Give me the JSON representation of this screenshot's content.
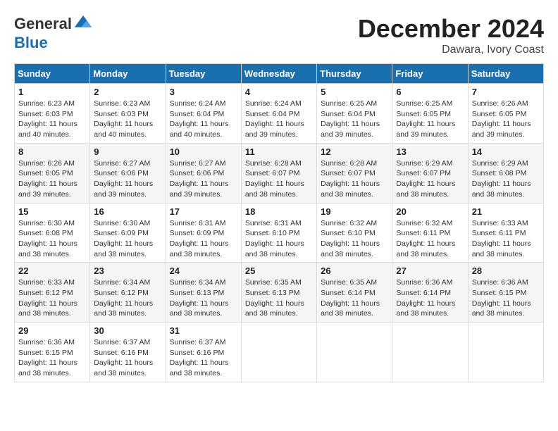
{
  "header": {
    "logo_general": "General",
    "logo_blue": "Blue",
    "month_title": "December 2024",
    "location": "Dawara, Ivory Coast"
  },
  "days_of_week": [
    "Sunday",
    "Monday",
    "Tuesday",
    "Wednesday",
    "Thursday",
    "Friday",
    "Saturday"
  ],
  "weeks": [
    [
      {
        "day": "1",
        "sunrise": "6:23 AM",
        "sunset": "6:03 PM",
        "daylight": "11 hours and 40 minutes."
      },
      {
        "day": "2",
        "sunrise": "6:23 AM",
        "sunset": "6:03 PM",
        "daylight": "11 hours and 40 minutes."
      },
      {
        "day": "3",
        "sunrise": "6:24 AM",
        "sunset": "6:04 PM",
        "daylight": "11 hours and 40 minutes."
      },
      {
        "day": "4",
        "sunrise": "6:24 AM",
        "sunset": "6:04 PM",
        "daylight": "11 hours and 39 minutes."
      },
      {
        "day": "5",
        "sunrise": "6:25 AM",
        "sunset": "6:04 PM",
        "daylight": "11 hours and 39 minutes."
      },
      {
        "day": "6",
        "sunrise": "6:25 AM",
        "sunset": "6:05 PM",
        "daylight": "11 hours and 39 minutes."
      },
      {
        "day": "7",
        "sunrise": "6:26 AM",
        "sunset": "6:05 PM",
        "daylight": "11 hours and 39 minutes."
      }
    ],
    [
      {
        "day": "8",
        "sunrise": "6:26 AM",
        "sunset": "6:05 PM",
        "daylight": "11 hours and 39 minutes."
      },
      {
        "day": "9",
        "sunrise": "6:27 AM",
        "sunset": "6:06 PM",
        "daylight": "11 hours and 39 minutes."
      },
      {
        "day": "10",
        "sunrise": "6:27 AM",
        "sunset": "6:06 PM",
        "daylight": "11 hours and 39 minutes."
      },
      {
        "day": "11",
        "sunrise": "6:28 AM",
        "sunset": "6:07 PM",
        "daylight": "11 hours and 38 minutes."
      },
      {
        "day": "12",
        "sunrise": "6:28 AM",
        "sunset": "6:07 PM",
        "daylight": "11 hours and 38 minutes."
      },
      {
        "day": "13",
        "sunrise": "6:29 AM",
        "sunset": "6:07 PM",
        "daylight": "11 hours and 38 minutes."
      },
      {
        "day": "14",
        "sunrise": "6:29 AM",
        "sunset": "6:08 PM",
        "daylight": "11 hours and 38 minutes."
      }
    ],
    [
      {
        "day": "15",
        "sunrise": "6:30 AM",
        "sunset": "6:08 PM",
        "daylight": "11 hours and 38 minutes."
      },
      {
        "day": "16",
        "sunrise": "6:30 AM",
        "sunset": "6:09 PM",
        "daylight": "11 hours and 38 minutes."
      },
      {
        "day": "17",
        "sunrise": "6:31 AM",
        "sunset": "6:09 PM",
        "daylight": "11 hours and 38 minutes."
      },
      {
        "day": "18",
        "sunrise": "6:31 AM",
        "sunset": "6:10 PM",
        "daylight": "11 hours and 38 minutes."
      },
      {
        "day": "19",
        "sunrise": "6:32 AM",
        "sunset": "6:10 PM",
        "daylight": "11 hours and 38 minutes."
      },
      {
        "day": "20",
        "sunrise": "6:32 AM",
        "sunset": "6:11 PM",
        "daylight": "11 hours and 38 minutes."
      },
      {
        "day": "21",
        "sunrise": "6:33 AM",
        "sunset": "6:11 PM",
        "daylight": "11 hours and 38 minutes."
      }
    ],
    [
      {
        "day": "22",
        "sunrise": "6:33 AM",
        "sunset": "6:12 PM",
        "daylight": "11 hours and 38 minutes."
      },
      {
        "day": "23",
        "sunrise": "6:34 AM",
        "sunset": "6:12 PM",
        "daylight": "11 hours and 38 minutes."
      },
      {
        "day": "24",
        "sunrise": "6:34 AM",
        "sunset": "6:13 PM",
        "daylight": "11 hours and 38 minutes."
      },
      {
        "day": "25",
        "sunrise": "6:35 AM",
        "sunset": "6:13 PM",
        "daylight": "11 hours and 38 minutes."
      },
      {
        "day": "26",
        "sunrise": "6:35 AM",
        "sunset": "6:14 PM",
        "daylight": "11 hours and 38 minutes."
      },
      {
        "day": "27",
        "sunrise": "6:36 AM",
        "sunset": "6:14 PM",
        "daylight": "11 hours and 38 minutes."
      },
      {
        "day": "28",
        "sunrise": "6:36 AM",
        "sunset": "6:15 PM",
        "daylight": "11 hours and 38 minutes."
      }
    ],
    [
      {
        "day": "29",
        "sunrise": "6:36 AM",
        "sunset": "6:15 PM",
        "daylight": "11 hours and 38 minutes."
      },
      {
        "day": "30",
        "sunrise": "6:37 AM",
        "sunset": "6:16 PM",
        "daylight": "11 hours and 38 minutes."
      },
      {
        "day": "31",
        "sunrise": "6:37 AM",
        "sunset": "6:16 PM",
        "daylight": "11 hours and 38 minutes."
      },
      null,
      null,
      null,
      null
    ]
  ],
  "labels": {
    "sunrise": "Sunrise:",
    "sunset": "Sunset:",
    "daylight": "Daylight:"
  }
}
